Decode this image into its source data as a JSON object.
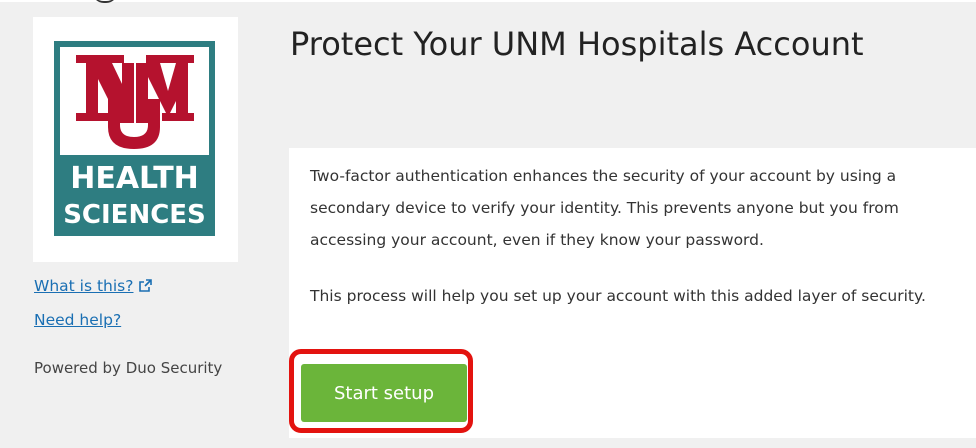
{
  "logo": {
    "line1": "HEALTH",
    "line2": "SCIENCES",
    "brand_teal": "#2e7d81",
    "brand_red": "#b5122e"
  },
  "sidebar": {
    "what_is_this_link": "What is this?",
    "need_help_link": "Need help?",
    "powered_by": "Powered by Duo Security"
  },
  "main": {
    "title": "Protect Your UNM Hospitals Account",
    "paragraph1": "Two-factor authentication enhances the security of your account by using a secondary device to verify your identity. This prevents anyone but you from accessing your account, even if they know your password.",
    "paragraph2": "This process will help you set up your account with this added layer of security.",
    "start_button": "Start setup"
  },
  "colors": {
    "link": "#1a6fb3",
    "button": "#6bb53a",
    "highlight": "#e3130f",
    "background": "#f0f0f0"
  }
}
